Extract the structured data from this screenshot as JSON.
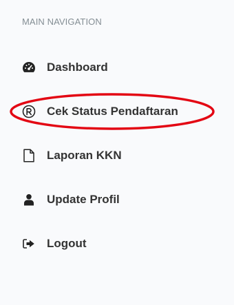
{
  "sidebar": {
    "section_header": "MAIN NAVIGATION",
    "items": [
      {
        "label": "Dashboard",
        "icon": "dashboard-icon"
      },
      {
        "label": "Cek Status Pendaftaran",
        "icon": "registered-icon"
      },
      {
        "label": "Laporan KKN",
        "icon": "file-icon"
      },
      {
        "label": "Update Profil",
        "icon": "user-icon"
      },
      {
        "label": "Logout",
        "icon": "logout-icon"
      }
    ]
  },
  "colors": {
    "background": "#f9fafc",
    "text": "#333333",
    "section_header": "#848e94",
    "highlight": "#e30613"
  }
}
